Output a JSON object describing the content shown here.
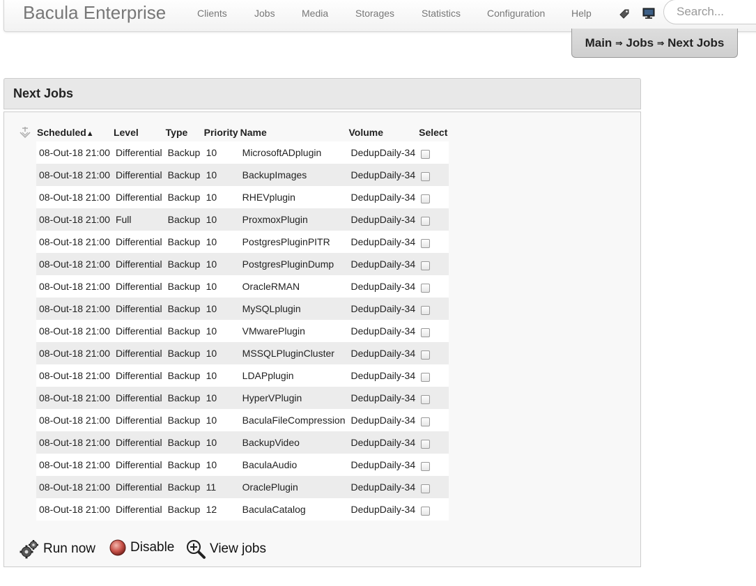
{
  "app": {
    "brand": "Bacula Enterprise"
  },
  "nav": {
    "items": [
      "Clients",
      "Jobs",
      "Media",
      "Storages",
      "Statistics",
      "Configuration",
      "Help"
    ],
    "icons": [
      "tag-icon",
      "monitor-icon"
    ]
  },
  "search": {
    "placeholder": "Search..."
  },
  "breadcrumb": {
    "items": [
      "Main",
      "Jobs",
      "Next Jobs"
    ],
    "separator": "⇒"
  },
  "panel": {
    "title": "Next Jobs"
  },
  "table": {
    "columns": [
      "Scheduled",
      "Level",
      "Type",
      "Priority",
      "Name",
      "Volume",
      "Select"
    ],
    "sort_indicator": "▲",
    "rows": [
      [
        "08-Out-18 21:00",
        "Differential",
        "Backup",
        "10",
        "MicrosoftADplugin",
        "DedupDaily-34"
      ],
      [
        "08-Out-18 21:00",
        "Differential",
        "Backup",
        "10",
        "BackupImages",
        "DedupDaily-34"
      ],
      [
        "08-Out-18 21:00",
        "Differential",
        "Backup",
        "10",
        "RHEVplugin",
        "DedupDaily-34"
      ],
      [
        "08-Out-18 21:00",
        "Full",
        "Backup",
        "10",
        "ProxmoxPlugin",
        "DedupDaily-34"
      ],
      [
        "08-Out-18 21:00",
        "Differential",
        "Backup",
        "10",
        "PostgresPluginPITR",
        "DedupDaily-34"
      ],
      [
        "08-Out-18 21:00",
        "Differential",
        "Backup",
        "10",
        "PostgresPluginDump",
        "DedupDaily-34"
      ],
      [
        "08-Out-18 21:00",
        "Differential",
        "Backup",
        "10",
        "OracleRMAN",
        "DedupDaily-34"
      ],
      [
        "08-Out-18 21:00",
        "Differential",
        "Backup",
        "10",
        "MySQLplugin",
        "DedupDaily-34"
      ],
      [
        "08-Out-18 21:00",
        "Differential",
        "Backup",
        "10",
        "VMwarePlugin",
        "DedupDaily-34"
      ],
      [
        "08-Out-18 21:00",
        "Differential",
        "Backup",
        "10",
        "MSSQLPluginCluster",
        "DedupDaily-34"
      ],
      [
        "08-Out-18 21:00",
        "Differential",
        "Backup",
        "10",
        "LDAPplugin",
        "DedupDaily-34"
      ],
      [
        "08-Out-18 21:00",
        "Differential",
        "Backup",
        "10",
        "HyperVPlugin",
        "DedupDaily-34"
      ],
      [
        "08-Out-18 21:00",
        "Differential",
        "Backup",
        "10",
        "BaculaFileCompression",
        "DedupDaily-34"
      ],
      [
        "08-Out-18 21:00",
        "Differential",
        "Backup",
        "10",
        "BackupVideo",
        "DedupDaily-34"
      ],
      [
        "08-Out-18 21:00",
        "Differential",
        "Backup",
        "10",
        "BaculaAudio",
        "DedupDaily-34"
      ],
      [
        "08-Out-18 21:00",
        "Differential",
        "Backup",
        "11",
        "OraclePlugin",
        "DedupDaily-34"
      ],
      [
        "08-Out-18 21:00",
        "Differential",
        "Backup",
        "12",
        "BaculaCatalog",
        "DedupDaily-34"
      ]
    ]
  },
  "actions": {
    "run_now": "Run now",
    "disable": "Disable",
    "view_jobs": "View jobs"
  },
  "colors": {
    "row_alt": "#ececec",
    "panel_header": "#e8e8e8",
    "nav_text": "#777777"
  }
}
